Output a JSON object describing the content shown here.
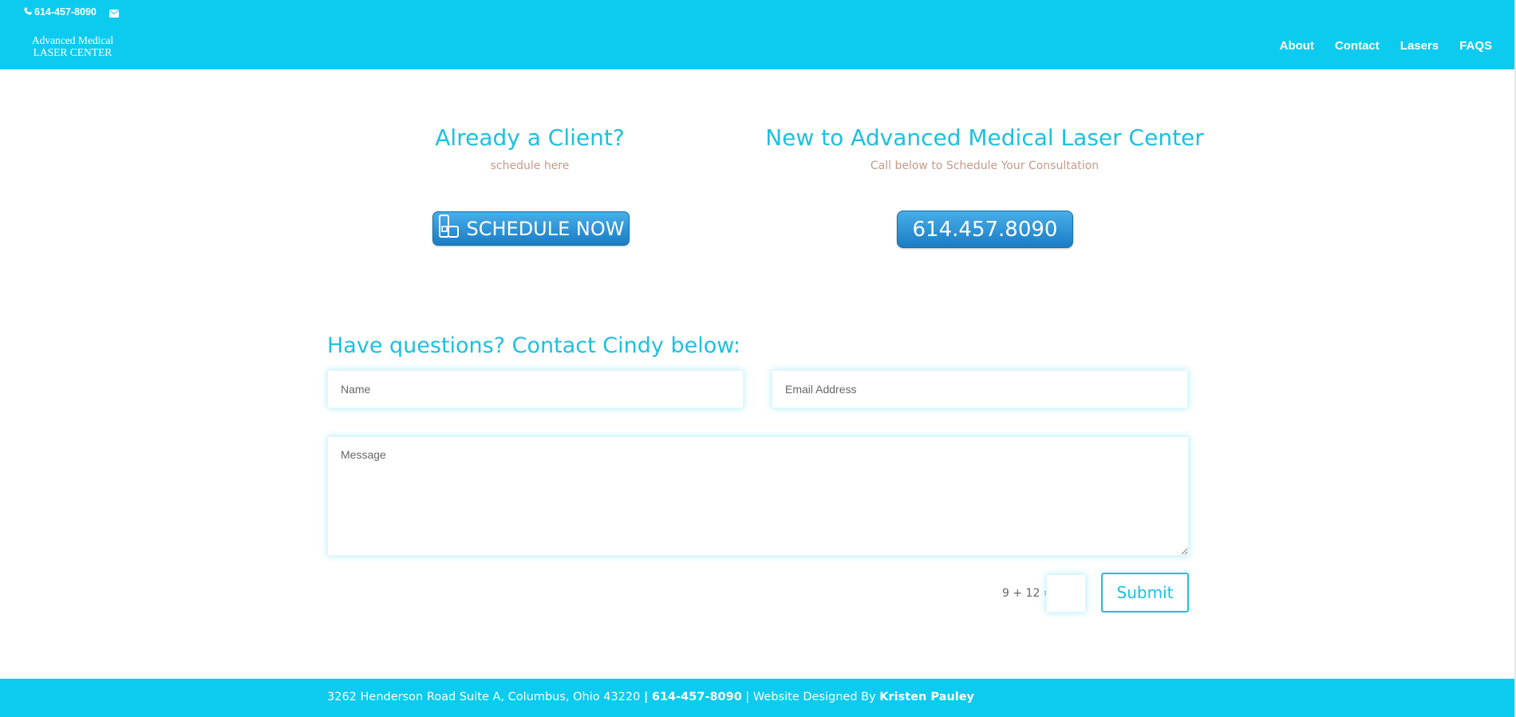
{
  "header": {
    "phone": "614-457-8090",
    "logo_line1": "Advanced Medical",
    "logo_line2": "LASER CENTER",
    "nav": [
      "About",
      "Contact",
      "Lasers",
      "FAQS"
    ]
  },
  "existing_client": {
    "heading": "Already a Client?",
    "subheading": "schedule here",
    "button_label": "SCHEDULE NOW"
  },
  "new_client": {
    "heading": "New to Advanced Medical Laser Center",
    "subheading": "Call below to Schedule Your Consultation",
    "button_label": "614.457.8090"
  },
  "contact_form": {
    "title": "Have questions? Contact Cindy below:",
    "name_placeholder": "Name",
    "email_placeholder": "Email Address",
    "message_placeholder": "Message",
    "captcha_question": "9 + 12 =",
    "submit_label": "Submit"
  },
  "footer": {
    "address": "3262 Henderson Road Suite A, Columbus, Ohio 43220",
    "separator": "|",
    "phone": "614-457-8090",
    "designed_by_label": "Website Designed By",
    "designer": "Kristen Pauley"
  },
  "colors": {
    "brand": "#0ccbef",
    "heading": "#1cc0e0",
    "subtext": "#c59a8a",
    "button": "#2a8fd4"
  },
  "icons": [
    "phone-icon",
    "email-icon",
    "calendar-icon"
  ]
}
